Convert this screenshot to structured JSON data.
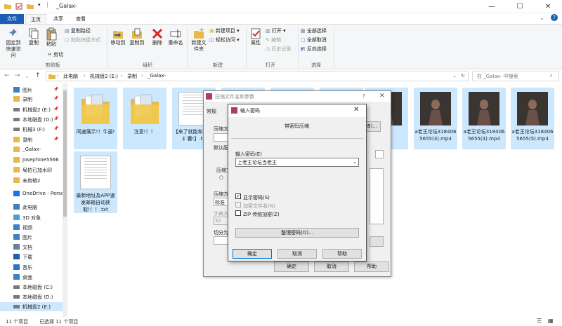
{
  "window": {
    "title": "_Galax-",
    "controls": [
      "—",
      "☐",
      "✕"
    ]
  },
  "ribbon_tabs": [
    "文件",
    "主页",
    "共享",
    "查看"
  ],
  "ribbon": {
    "clipboard": {
      "pin_label": "固定到快速访问",
      "copy_label": "复制",
      "paste_label": "粘贴",
      "copy_path": "复制路径",
      "paste_shortcut": "粘贴快捷方式",
      "cut": "剪切",
      "group_label": "剪贴板"
    },
    "organize": {
      "move_to": "移动到",
      "copy_to": "复制到",
      "delete": "删除",
      "rename": "重命名",
      "group_label": "组织"
    },
    "new": {
      "new_folder": "新建文件夹",
      "new_item": "新建项目",
      "easy_access": "轻松访问",
      "group_label": "新建"
    },
    "open": {
      "properties": "属性",
      "open": "打开",
      "edit": "编辑",
      "history": "历史记录",
      "group_label": "打开"
    },
    "select": {
      "select_all": "全部选择",
      "select_none": "全部取消",
      "invert": "反向选择",
      "group_label": "选择"
    }
  },
  "address": {
    "path": [
      "此电脑",
      "机械盘2 (E:)",
      "录制",
      "_Galax-"
    ],
    "search_placeholder": "在 _Galax- 中搜索"
  },
  "nav": {
    "items": [
      {
        "label": "图片",
        "icon": "pictures-icon",
        "pinned": true
      },
      {
        "label": "录制",
        "icon": "folder-icon",
        "pinned": true
      },
      {
        "label": "机械盘2 (E:)",
        "icon": "drive-icon",
        "pinned": true
      },
      {
        "label": "本地磁盘 (D:)",
        "icon": "drive-icon",
        "pinned": true
      },
      {
        "label": "机械3 (F:)",
        "icon": "drive-icon",
        "pinned": true
      },
      {
        "label": "录制",
        "icon": "folder-icon",
        "pinned": true
      },
      {
        "label": "_Galax-",
        "icon": "folder-icon",
        "pinned": false
      },
      {
        "label": "Josephine5566",
        "icon": "folder-icon",
        "pinned": false
      },
      {
        "label": "局拍已加水印",
        "icon": "folder-icon",
        "pinned": false
      },
      {
        "label": "未剪辑2",
        "icon": "folder-icon",
        "pinned": false
      },
      {
        "label": "OneDrive - Perso",
        "icon": "onedrive-icon",
        "pinned": false
      },
      {
        "label": "此电脑",
        "icon": "computer-icon",
        "pinned": false
      },
      {
        "label": "3D 对象",
        "icon": "3d-objects-icon",
        "pinned": false
      },
      {
        "label": "视频",
        "icon": "videos-icon",
        "pinned": false
      },
      {
        "label": "图片",
        "icon": "pictures-icon",
        "pinned": false
      },
      {
        "label": "文档",
        "icon": "documents-icon",
        "pinned": false
      },
      {
        "label": "下载",
        "icon": "download-icon",
        "pinned": false
      },
      {
        "label": "音乐",
        "icon": "music-icon",
        "pinned": false
      },
      {
        "label": "桌面",
        "icon": "desktop-icon",
        "pinned": false
      },
      {
        "label": "本地磁盘 (C:)",
        "icon": "drive-icon",
        "pinned": false
      },
      {
        "label": "本地磁盘 (D:)",
        "icon": "drive-icon",
        "pinned": false
      },
      {
        "label": "机械盘2 (E:)",
        "icon": "drive-icon",
        "pinned": false
      }
    ]
  },
  "files": [
    {
      "name": "同速展示!！牛逼!",
      "type": "folder"
    },
    {
      "name": "注意!！！",
      "type": "folder"
    },
    {
      "name": "【来了就能和观看! 纟囊!】.tx",
      "type": "doc"
    },
    {
      "name": "",
      "type": "folder"
    },
    {
      "name": "",
      "type": "folder"
    },
    {
      "name": "",
      "type": "video"
    },
    {
      "name": "",
      "type": "video"
    },
    {
      "name": "a老王论坛3184065655(3).mp4",
      "type": "video"
    },
    {
      "name": "a老王论坛3184065655(4).mp4",
      "type": "video"
    },
    {
      "name": "a老王论坛3184065655(5).mp4",
      "type": "video"
    },
    {
      "name": "最新地址及APP速发邮箱自动获取!！！.txt",
      "type": "doc"
    }
  ],
  "status": {
    "count": "11 个项目",
    "selected": "已选择 11 个项目"
  },
  "archive_dialog": {
    "title": "压缩文件名和参数",
    "help_mark": "?",
    "tab": "常规",
    "labels": {
      "archive_name": "压缩文",
      "default": "默认配",
      "format": "压缩文",
      "method": "压缩方",
      "method_value": "标准",
      "dict": "字典大",
      "dict_value": "32",
      "split": "切分为"
    },
    "buttons": {
      "ok": "确定",
      "cancel": "取消",
      "help": "帮助"
    }
  },
  "password_dialog": {
    "title": "输入密码",
    "header": "带密码压缩",
    "password_label": "输入密码(E)",
    "password_value": "上老王论坛当老王",
    "show_password": "显示密码(S)",
    "encrypt_names": "加密文件名(N)",
    "zip_legacy": "ZIP 传统加密(Z)",
    "organize": "整理密码(O)...",
    "buttons": {
      "ok": "确定",
      "cancel": "取消",
      "help": "帮助"
    }
  },
  "colors": {
    "accent": "#1a5fb4",
    "selection": "#cce8ff",
    "folder": "#e8b84a"
  }
}
